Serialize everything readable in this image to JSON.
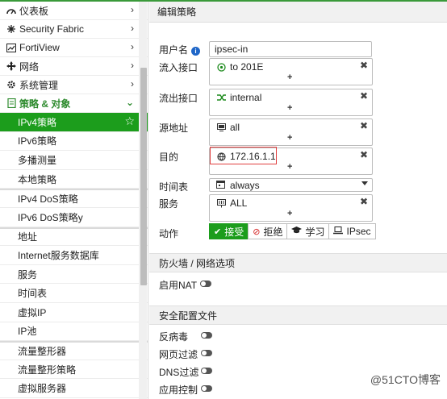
{
  "sidebar": {
    "top_items": [
      {
        "label": "仪表板",
        "icon": "dashboard-icon"
      },
      {
        "label": "Security Fabric",
        "icon": "fabric-icon"
      },
      {
        "label": "FortiView",
        "icon": "chart-icon"
      },
      {
        "label": "网络",
        "icon": "network-icon"
      },
      {
        "label": "系统管理",
        "icon": "gear-icon"
      }
    ],
    "section": {
      "label": "策略 & 对象",
      "icon": "policy-icon"
    },
    "sub_items": [
      "IPv4策略",
      "IPv6策略",
      "多播测量",
      "本地策略",
      "IPv4 DoS策略",
      "IPv6 DoS策略y",
      "地址",
      "Internet服务数据库",
      "服务",
      "时间表",
      "虚拟IP",
      "IP池",
      "流量整形器",
      "流量整形策略",
      "虚拟服务器"
    ]
  },
  "main": {
    "title": "编辑策略",
    "username_label": "用户名",
    "username_value": "ipsec-in",
    "incoming_label": "流入接口",
    "incoming_value": "to 201E",
    "outgoing_label": "流出接口",
    "outgoing_value": "internal",
    "source_label": "源地址",
    "source_value": "all",
    "dest_label": "目的",
    "dest_value": "172.16.1.1",
    "schedule_label": "时间表",
    "schedule_value": "always",
    "service_label": "服务",
    "service_value": "ALL",
    "action_label": "动作",
    "actions": {
      "accept": "接受",
      "deny": "拒绝",
      "learn": "学习",
      "ipsec": "IPsec"
    },
    "firewall_section": "防火墙 / 网络选项",
    "nat_label": "启用NAT",
    "security_section": "安全配置文件",
    "antivirus_label": "反病毒",
    "webfilter_label": "网页过滤",
    "dnsfilter_label": "DNS过滤",
    "app_label": "应用控制"
  },
  "watermark": "@51CTO博客",
  "colors": {
    "accent": "#1c9d1c",
    "highlight": "#e04040"
  }
}
